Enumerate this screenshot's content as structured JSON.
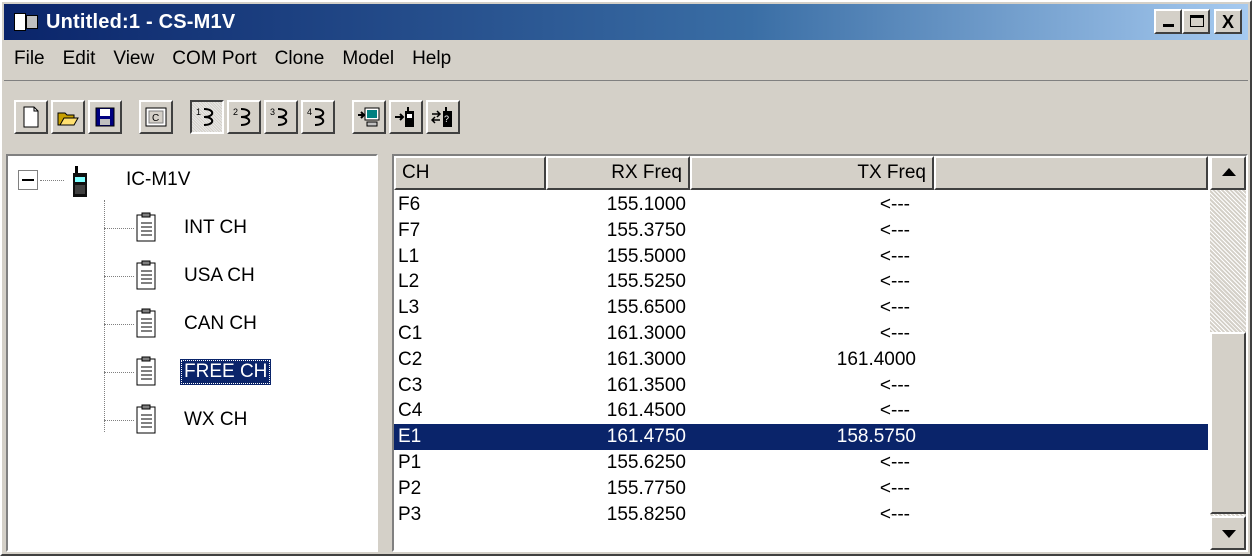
{
  "window": {
    "title": "Untitled:1 - CS-M1V",
    "buttons": {
      "minimize": "_",
      "close": "X"
    }
  },
  "menu": [
    "File",
    "Edit",
    "View",
    "COM Port",
    "Clone",
    "Model",
    "Help"
  ],
  "toolbar": {
    "buttons": [
      {
        "name": "new-icon"
      },
      {
        "name": "open-icon"
      },
      {
        "name": "save-icon"
      },
      {
        "name": "clipboard-c-icon"
      },
      {
        "name": "com1-icon"
      },
      {
        "name": "com2-icon"
      },
      {
        "name": "com3-icon"
      },
      {
        "name": "com4-icon"
      },
      {
        "name": "clone-to-pc-icon"
      },
      {
        "name": "clone-to-radio-icon"
      },
      {
        "name": "clone-exchange-icon"
      }
    ]
  },
  "tree": {
    "root": "IC-M1V",
    "items": [
      "INT CH",
      "USA CH",
      "CAN CH",
      "FREE CH",
      "WX CH"
    ],
    "selected": "FREE CH"
  },
  "list": {
    "columns": [
      "CH",
      "RX Freq",
      "TX Freq"
    ],
    "rows": [
      {
        "ch": "F6",
        "rx": "155.1000",
        "tx": "<---"
      },
      {
        "ch": "F7",
        "rx": "155.3750",
        "tx": "<---"
      },
      {
        "ch": "L1",
        "rx": "155.5000",
        "tx": "<---"
      },
      {
        "ch": "L2",
        "rx": "155.5250",
        "tx": "<---"
      },
      {
        "ch": "L3",
        "rx": "155.6500",
        "tx": "<---"
      },
      {
        "ch": "C1",
        "rx": "161.3000",
        "tx": "<---"
      },
      {
        "ch": "C2",
        "rx": "161.3000",
        "tx": "161.4000"
      },
      {
        "ch": "C3",
        "rx": "161.3500",
        "tx": "<---"
      },
      {
        "ch": "C4",
        "rx": "161.4500",
        "tx": "<---"
      },
      {
        "ch": "E1",
        "rx": "161.4750",
        "tx": "158.5750"
      },
      {
        "ch": "P1",
        "rx": "155.6250",
        "tx": "<---"
      },
      {
        "ch": "P2",
        "rx": "155.7750",
        "tx": "<---"
      },
      {
        "ch": "P3",
        "rx": "155.8250",
        "tx": "<---"
      }
    ],
    "selected_index": 9
  },
  "colors": {
    "titlebar_start": "#0a246a",
    "selection": "#0a246a",
    "face": "#d4d0c8"
  }
}
